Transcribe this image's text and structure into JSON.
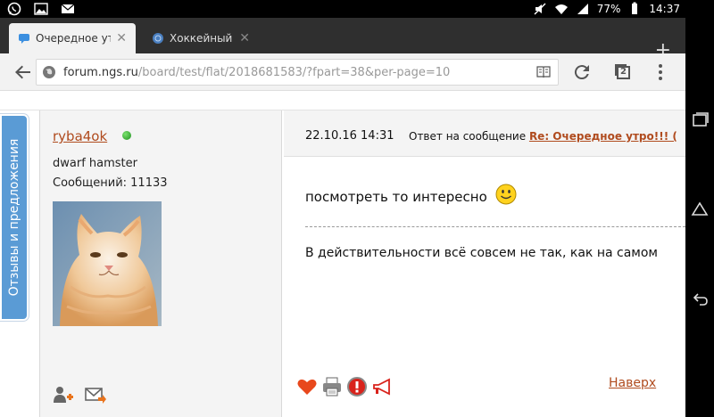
{
  "status_bar": {
    "battery": "77%",
    "time": "14:37",
    "icons": [
      "whatsapp-icon",
      "gallery-icon",
      "email-icon",
      "mute-icon",
      "wifi-icon",
      "signal-icon",
      "battery-icon"
    ]
  },
  "tabs": [
    {
      "title": "Очередное утро",
      "active": true
    },
    {
      "title": "Хоккейный к",
      "active": false
    }
  ],
  "address_bar": {
    "url_host": "forum.ngs.ru",
    "url_path": "/board/test/flat/2018681583/?fpart=38&per-page=10",
    "tab_count": "2"
  },
  "feedback_tab": {
    "label": "Отзывы и предложения"
  },
  "author": {
    "name": "ryba4ok",
    "title": "dwarf hamster",
    "posts": "Сообщений: 11133"
  },
  "post": {
    "date": "22.10.16 14:31",
    "reply_label": "Ответ на сообщение",
    "reply_link": "Re: Очередное утро!!! (",
    "text": "посмотреть то интересно",
    "signature": "В действительности всё совсем не так, как на самом",
    "to_top": "Наверх"
  },
  "colors": {
    "link": "#b04b1e",
    "feedback_tab": "#5a9bd5",
    "tab_strip": "#2f2f2f"
  }
}
